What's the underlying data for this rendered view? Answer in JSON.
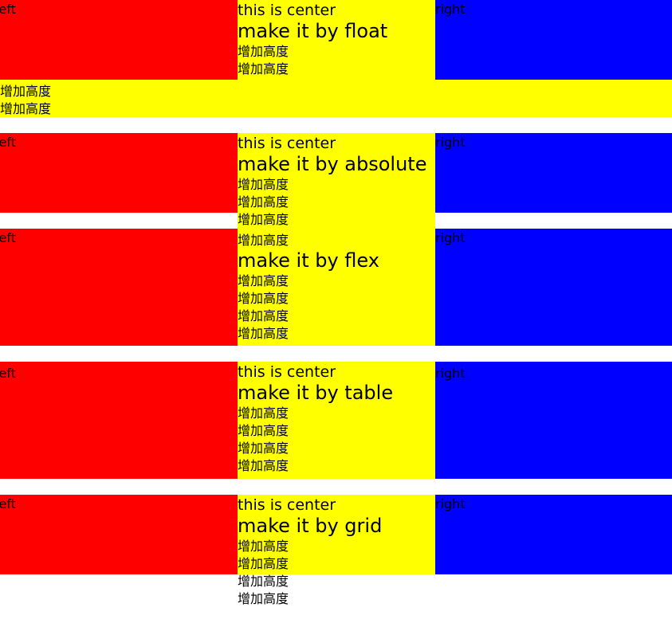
{
  "colors": {
    "left": "#ff0000",
    "center": "#ffff00",
    "right": "#0000ff"
  },
  "labels": {
    "left": "left",
    "right": "right",
    "extra": "增加高度"
  },
  "sections": [
    {
      "title": "this is center",
      "subtitle": "make it by float"
    },
    {
      "title": "this is center",
      "subtitle": "make it by absolute"
    },
    {
      "title": "",
      "subtitle": "make it by flex"
    },
    {
      "title": "this is center",
      "subtitle": "make it by table"
    },
    {
      "title": "this is center",
      "subtitle": "make it by grid"
    }
  ]
}
